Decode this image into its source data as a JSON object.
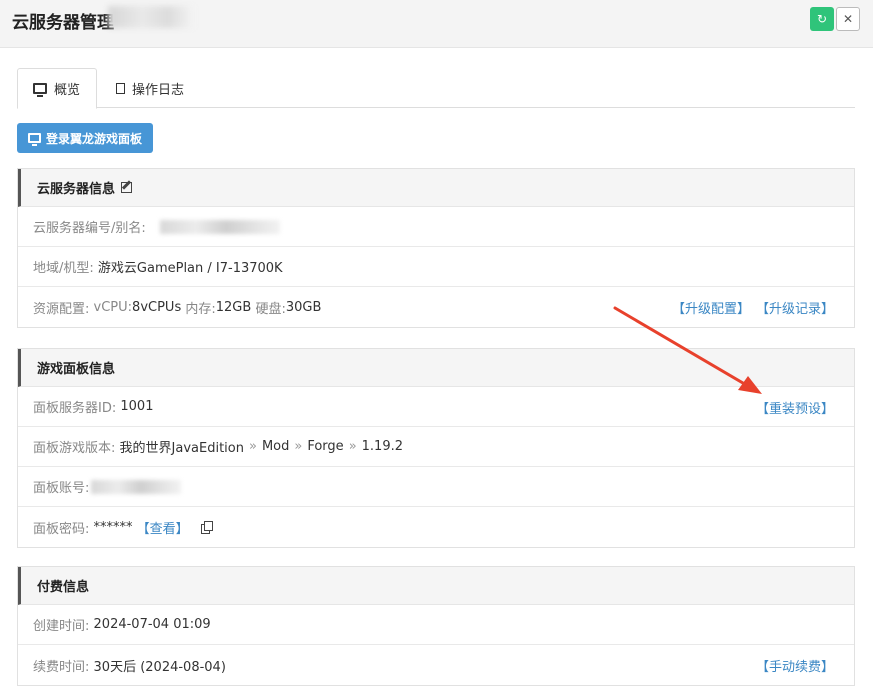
{
  "header": {
    "title": "云服务器管理"
  },
  "tabs": [
    {
      "label": "概览"
    },
    {
      "label": "操作日志"
    }
  ],
  "login_button": "登录翼龙游戏面板",
  "server_info": {
    "title": "云服务器信息",
    "id_label": "云服务器编号/别名:",
    "region_label": "地域/机型:",
    "region_value": "游戏云GamePlan / I7-13700K",
    "resource_label": "资源配置:",
    "vcpu_label": "vCPU:",
    "vcpu_value": "8vCPUs",
    "mem_label": "内存:",
    "mem_value": "12GB",
    "disk_label": "硬盘:",
    "disk_value": "30GB",
    "upgrade_link": "【升级配置】",
    "upgrade_log_link": "【升级记录】"
  },
  "panel_info": {
    "title": "游戏面板信息",
    "server_id_label": "面板服务器ID:",
    "server_id_value": "1001",
    "reinstall_link": "【重装预设】",
    "version_label": "面板游戏版本:",
    "version_parts": [
      "我的世界JavaEdition",
      "Mod",
      "Forge",
      "1.19.2"
    ],
    "account_label": "面板账号:",
    "password_label": "面板密码:",
    "password_value": "******",
    "view_link": "【查看】"
  },
  "billing": {
    "title": "付费信息",
    "created_label": "创建时间:",
    "created_value": "2024-07-04 01:09",
    "renew_label": "续费时间:",
    "renew_value": "30天后 (2024-08-04)",
    "renew_link": "【手动续费】"
  },
  "colors": {
    "accent": "#4796d6",
    "link": "#3b87c4",
    "refresh": "#2fc47a",
    "arrow": "#e8412c"
  }
}
